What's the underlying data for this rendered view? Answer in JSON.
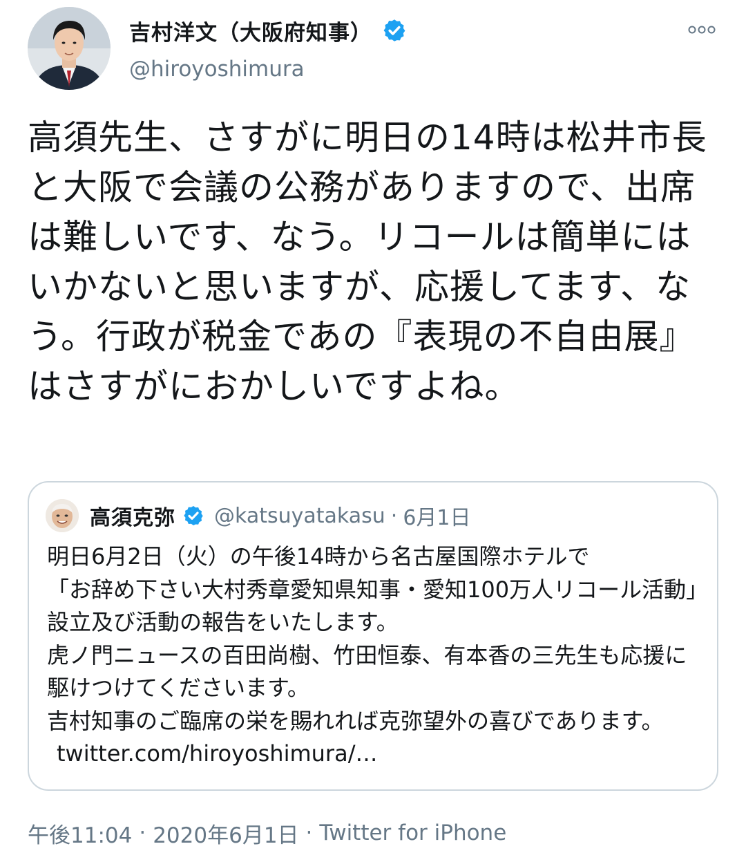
{
  "author": {
    "display_name": "吉村洋文（大阪府知事）",
    "handle": "@hiroyoshimura",
    "verified_icon": "verified-badge-icon",
    "avatar": "avatar-photo"
  },
  "more_icon": "more-options-icon",
  "tweet": {
    "text": "高須先生、さすがに明日の14時は松井市長と大阪で会議の公務がありますので、出席は難しいです、なう。リコールは簡単にはいかないと思いますが、応援してます、なう。行政が税金であの『表現の不自由展』はさすがにおかしいですよね。"
  },
  "quoted_tweet": {
    "display_name": "高須克弥",
    "handle": "@katsuyatakasu",
    "separator": "·",
    "date": "6月1日",
    "text": "明日6月2日（火）の午後14時から名古屋国際ホテルで\n「お辞め下さい大村秀章愛知県知事・愛知100万人リコール活動」設立及び活動の報告をいたします。\n虎ノ門ニュースの百田尚樹、竹田恒泰、有本香の三先生も応援に駆けつけてくださいます。\n吉村知事のご臨席の栄を賜れれば克弥望外の喜びであります。",
    "link": "twitter.com/hiroyoshimura/…"
  },
  "footer": {
    "time": "午後11:04",
    "sep1": "·",
    "date": "2020年6月1日",
    "sep2": "·",
    "source": "Twitter for iPhone"
  },
  "colors": {
    "text": "#14171a",
    "secondary": "#657786",
    "verified": "#1da1f2",
    "border": "#ccd6dd"
  }
}
